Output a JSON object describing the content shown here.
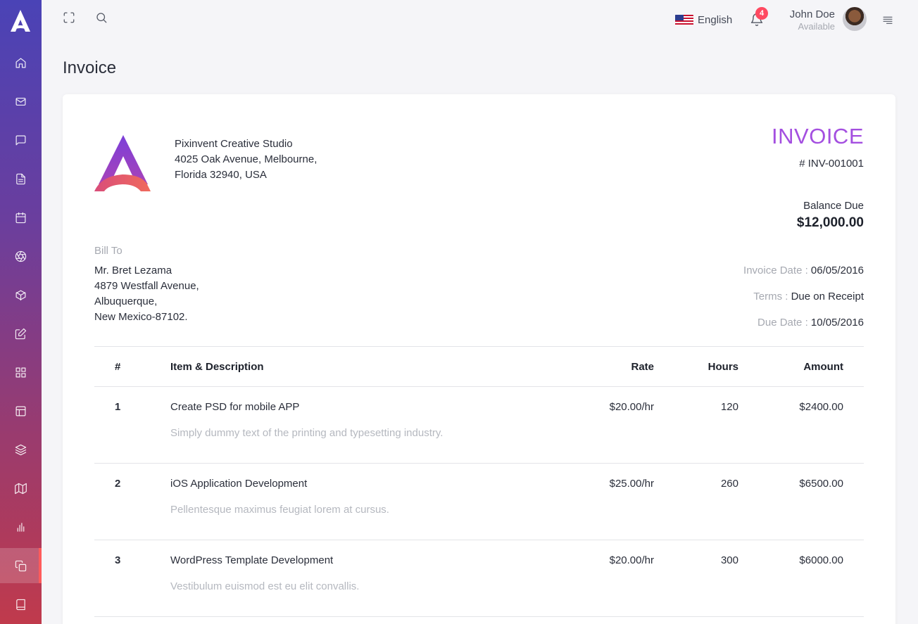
{
  "sidebar": {
    "logo_icon": "logo-a-icon",
    "items": [
      {
        "icon": "home-icon"
      },
      {
        "icon": "mail-icon"
      },
      {
        "icon": "chat-icon"
      },
      {
        "icon": "file-icon"
      },
      {
        "icon": "calendar-icon"
      },
      {
        "icon": "aperture-icon"
      },
      {
        "icon": "box-icon"
      },
      {
        "icon": "edit-icon"
      },
      {
        "icon": "grid-icon"
      },
      {
        "icon": "layout-icon"
      },
      {
        "icon": "layers-icon"
      },
      {
        "icon": "map-icon"
      },
      {
        "icon": "bar-chart-icon"
      },
      {
        "icon": "copy-icon",
        "active": true
      },
      {
        "icon": "book-icon"
      }
    ]
  },
  "topbar": {
    "language": "English",
    "notification_count": "4",
    "user": {
      "name": "John Doe",
      "status": "Available"
    }
  },
  "page": {
    "title": "Invoice"
  },
  "invoice": {
    "company_lines": [
      "Pixinvent Creative Studio",
      "4025 Oak Avenue, Melbourne,",
      "Florida 32940, USA"
    ],
    "title": "INVOICE",
    "number": "# INV-001001",
    "balance_label": "Balance Due",
    "balance_amount": "$12,000.00",
    "bill_to_label": "Bill To",
    "bill_to_lines": [
      "Mr. Bret Lezama",
      "4879 Westfall Avenue,",
      "Albuquerque,",
      "New Mexico-87102."
    ],
    "meta": [
      {
        "label": "Invoice Date :",
        "value": "06/05/2016"
      },
      {
        "label": "Terms :",
        "value": "Due on Receipt"
      },
      {
        "label": "Due Date :",
        "value": "10/05/2016"
      }
    ],
    "table": {
      "headers": {
        "idx": "#",
        "item": "Item & Description",
        "rate": "Rate",
        "hours": "Hours",
        "amount": "Amount"
      },
      "rows": [
        {
          "idx": "1",
          "item": "Create PSD for mobile APP",
          "desc": "Simply dummy text of the printing and typesetting industry.",
          "rate": "$20.00/hr",
          "hours": "120",
          "amount": "$2400.00"
        },
        {
          "idx": "2",
          "item": "iOS Application Development",
          "desc": "Pellentesque maximus feugiat lorem at cursus.",
          "rate": "$25.00/hr",
          "hours": "260",
          "amount": "$6500.00"
        },
        {
          "idx": "3",
          "item": "WordPress Template Development",
          "desc": "Vestibulum euismod est eu elit convallis.",
          "rate": "$20.00/hr",
          "hours": "300",
          "amount": "$6000.00"
        }
      ]
    }
  },
  "colors": {
    "accent": "#a44fe0",
    "badge": "#ff4961",
    "sidebar_top": "#4a43b6",
    "sidebar_bottom": "#c03a4c"
  }
}
